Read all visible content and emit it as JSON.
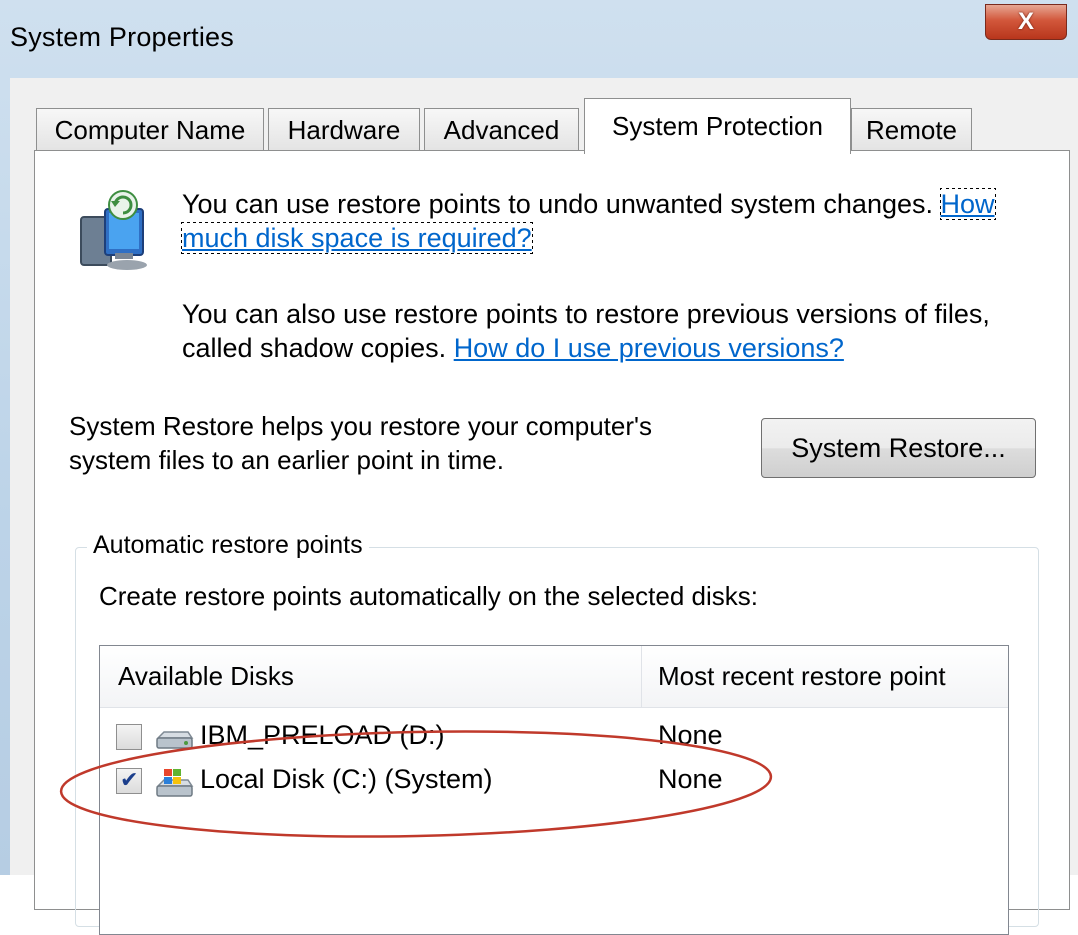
{
  "window": {
    "title": "System Properties",
    "close_label": "X"
  },
  "tabs": [
    {
      "label": "Computer Name",
      "active": false
    },
    {
      "label": "Hardware",
      "active": false
    },
    {
      "label": "Advanced",
      "active": false
    },
    {
      "label": "System Protection",
      "active": true
    },
    {
      "label": "Remote",
      "active": false
    }
  ],
  "intro": {
    "text1": "You can use restore points to undo unwanted system changes.",
    "link1": "How much disk space is required?",
    "text2": "You can also use restore points to restore previous versions of files, called shadow copies.",
    "link2": "How do I use previous versions?"
  },
  "restore": {
    "description": "System Restore helps you restore your computer's system files to an earlier point in time.",
    "button_label": "System Restore..."
  },
  "auto_restore": {
    "group_label": "Automatic restore points",
    "description": "Create restore points automatically on the selected disks:",
    "columns": [
      "Available Disks",
      "Most recent restore point"
    ],
    "disks": [
      {
        "name": "IBM_PRELOAD (D:)",
        "restore_point": "None",
        "checked": false,
        "icon": "drive-icon"
      },
      {
        "name": "Local Disk (C:) (System)",
        "restore_point": "None",
        "checked": true,
        "icon": "system-drive-icon"
      }
    ]
  },
  "colors": {
    "link": "#0066cc",
    "annotation": "#c0392b"
  }
}
